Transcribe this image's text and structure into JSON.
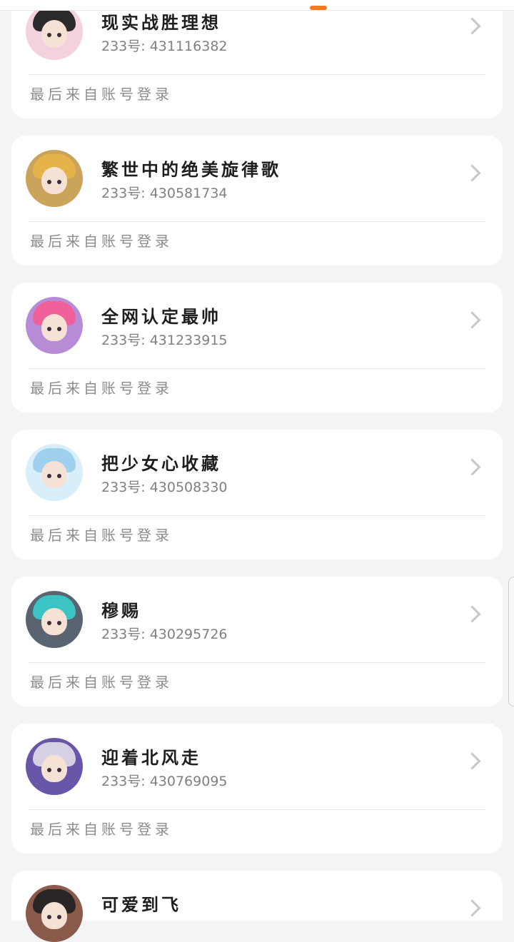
{
  "accounts": [
    {
      "name": "现实战胜理想",
      "account_line": "233号: 431116382",
      "login_source": "最后来自账号登录",
      "avatar_icon": "anime-avatar-icon",
      "hair_color": "#2a2a2a",
      "bg_color": "#f3d2dd"
    },
    {
      "name": "繁世中的绝美旋律歌",
      "account_line": "233号: 430581734",
      "login_source": "最后来自账号登录",
      "avatar_icon": "anime-avatar-icon",
      "hair_color": "#e6b24a",
      "bg_color": "#c9a45a"
    },
    {
      "name": "全网认定最帅",
      "account_line": "233号: 431233915",
      "login_source": "最后来自账号登录",
      "avatar_icon": "anime-avatar-icon",
      "hair_color": "#f0609a",
      "bg_color": "#b78bd6"
    },
    {
      "name": "把少女心收藏",
      "account_line": "233号: 430508330",
      "login_source": "最后来自账号登录",
      "avatar_icon": "anime-avatar-icon",
      "hair_color": "#9fd0ee",
      "bg_color": "#d8eefa"
    },
    {
      "name": "穆赐",
      "account_line": "233号: 430295726",
      "login_source": "最后来自账号登录",
      "avatar_icon": "anime-avatar-icon",
      "hair_color": "#3cc4c4",
      "bg_color": "#5a6470"
    },
    {
      "name": "迎着北风走",
      "account_line": "233号: 430769095",
      "login_source": "最后来自账号登录",
      "avatar_icon": "anime-avatar-icon",
      "hair_color": "#d6d0e4",
      "bg_color": "#6a56a8"
    },
    {
      "name": "可爱到飞",
      "account_line": "",
      "login_source": "",
      "avatar_icon": "anime-avatar-icon",
      "hair_color": "#2b2626",
      "bg_color": "#8a5a4a"
    }
  ],
  "colors": {
    "accent": "#f47a1f",
    "background": "#f4f4f4",
    "card": "#ffffff"
  },
  "icons": {
    "chevron": "chevron-right-icon"
  }
}
